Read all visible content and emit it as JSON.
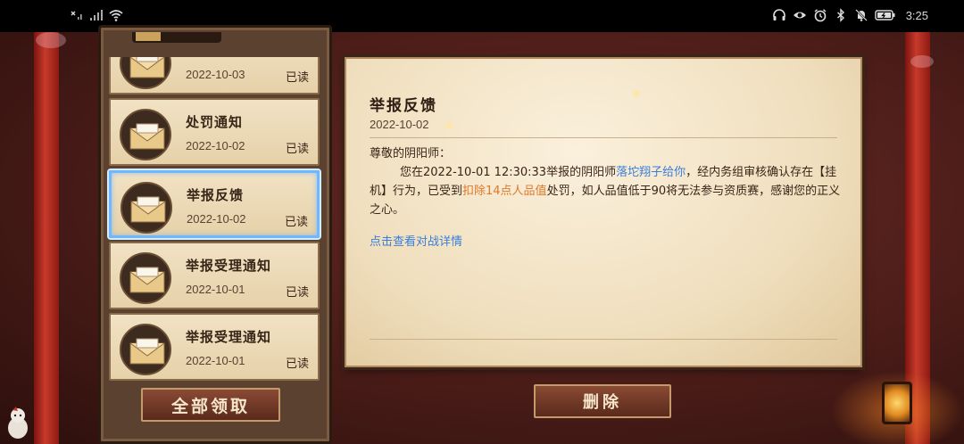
{
  "status_bar": {
    "left_icons": [
      "sim-off-icon",
      "signal-icon",
      "wifi-icon"
    ],
    "right_icons": [
      "headphones-icon",
      "eye-icon",
      "alarm-icon",
      "bluetooth-icon",
      "mute-icon",
      "battery-icon"
    ],
    "time": "3:25"
  },
  "mail_list": {
    "items": [
      {
        "title": "",
        "date": "2022-10-03",
        "status": "已读"
      },
      {
        "title": "处罚通知",
        "date": "2022-10-02",
        "status": "已读"
      },
      {
        "title": "举报反馈",
        "date": "2022-10-02",
        "status": "已读",
        "selected": true
      },
      {
        "title": "举报受理通知",
        "date": "2022-10-01",
        "status": "已读"
      },
      {
        "title": "举报受理通知",
        "date": "2022-10-01",
        "status": "已读"
      }
    ],
    "claim_all_label": "全部领取"
  },
  "letter": {
    "title": "举报反馈",
    "date": "2022-10-02",
    "greeting": "尊敬的阴阳师：",
    "body_part1": "您在2022-10-01 12:30:33举报的阴阳师",
    "reported_player": "落坨翔子给你",
    "body_part2": "，经内务组审核确认存在【挂机】行为，已受到",
    "penalty": "扣除14点人品值",
    "body_part3": "处罚，如人品值低于90将无法参与资质赛，感谢您的正义之心。",
    "detail_link": "点击查看对战详情",
    "delete_label": "删除"
  },
  "colors": {
    "link_blue": "#3a7ed8",
    "penalty_orange": "#e0782a",
    "selected_border": "#6fb8ff"
  }
}
